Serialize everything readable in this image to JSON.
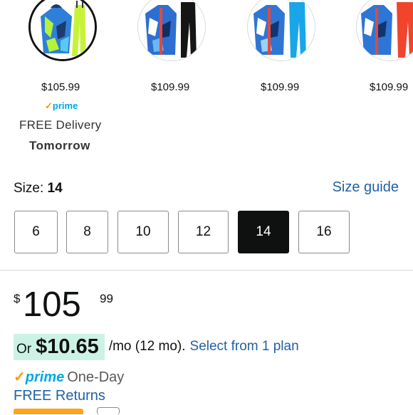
{
  "swatches": [
    {
      "price": "$105.99",
      "prime": "prime",
      "delivery_line1": "FREE Delivery",
      "delivery_line2": "Tomorrow",
      "selected": true
    },
    {
      "price": "$109.99",
      "selected": false
    },
    {
      "price": "$109.99",
      "selected": false
    },
    {
      "price": "$109.99",
      "selected": false
    }
  ],
  "size": {
    "label": "Size: ",
    "value": "14",
    "guide_link": "Size guide",
    "options": [
      "6",
      "8",
      "10",
      "12",
      "14",
      "16"
    ],
    "selected": "14"
  },
  "price": {
    "symbol": "$",
    "whole": "105",
    "fraction": "99"
  },
  "installment": {
    "or": "Or",
    "amount": "$10.65",
    "term": "/mo (12 mo).",
    "link": "Select from 1 plan"
  },
  "prime_delivery": {
    "check": "✓",
    "prime": "prime",
    "speed": "One-Day"
  },
  "returns": "FREE Returns",
  "colors": {
    "link": "#2162A1",
    "prime_blue": "#00A8E1",
    "prime_check": "#FF9900",
    "selected_bg": "#0F1111",
    "installment_highlight": "#CCF2E6"
  }
}
